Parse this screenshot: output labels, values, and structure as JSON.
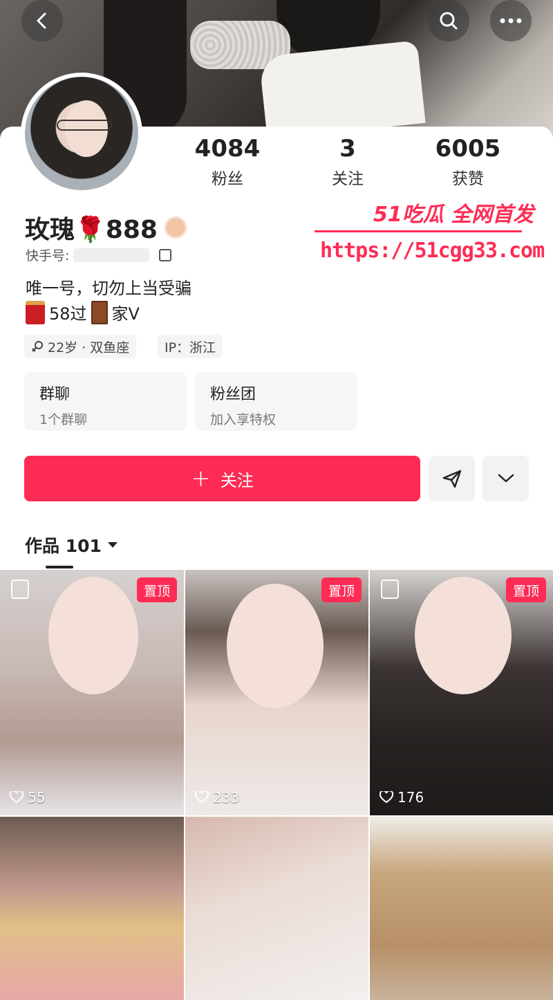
{
  "profile": {
    "name": "玫瑰🌹888",
    "uid_label": "快手号:",
    "bio": "唯一号，切勿上当受骗",
    "tagline_a": "58过",
    "tagline_b": "家V",
    "age_chip": "22岁 · 双鱼座",
    "ip_chip": "IP：浙江"
  },
  "stats": {
    "fans": {
      "value": "4084",
      "label": "粉丝"
    },
    "following": {
      "value": "3",
      "label": "关注"
    },
    "likes": {
      "value": "6005",
      "label": "获赞"
    }
  },
  "tiles": {
    "group": {
      "title": "群聊",
      "sub": "1个群聊"
    },
    "fanclub": {
      "title": "粉丝团",
      "sub": "加入享特权"
    }
  },
  "actions": {
    "follow": "关注"
  },
  "works": {
    "label": "作品 101"
  },
  "watermark": {
    "brand": "51吃瓜 全网首发",
    "url": "https://51cgg33.com"
  },
  "grid": {
    "items": [
      {
        "pinned": "置顶",
        "likes": "55",
        "type": "image"
      },
      {
        "pinned": "置顶",
        "likes": "233",
        "type": "video"
      },
      {
        "pinned": "置顶",
        "likes": "176",
        "type": "image"
      },
      {
        "pinned": "",
        "likes": "",
        "type": "video"
      },
      {
        "pinned": "",
        "likes": "",
        "type": "video"
      },
      {
        "pinned": "",
        "likes": "",
        "type": "video"
      }
    ]
  },
  "colors": {
    "accent": "#fe2c55",
    "tile_bg": "#f6f6f6"
  },
  "icons": [
    "back-icon",
    "search-icon",
    "more-icon",
    "copy-icon",
    "share-icon",
    "chevron-down-icon",
    "heart-icon",
    "gallery-icon"
  ]
}
